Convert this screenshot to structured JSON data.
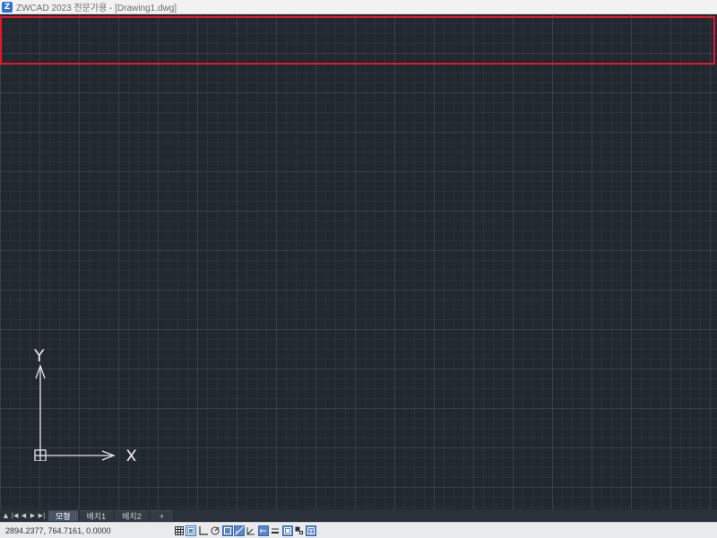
{
  "window": {
    "logo_glyph": "Z",
    "title": "ZWCAD 2023 전문가용 - [Drawing1.dwg]"
  },
  "canvas": {
    "background": "#212830",
    "highlight_color": "#e8162a",
    "axis_x_label": "X",
    "axis_y_label": "Y"
  },
  "layout_tabs": {
    "nav": [
      "▲",
      "|◀",
      "◀",
      "▶",
      "▶|"
    ],
    "tabs": [
      {
        "label": "모형",
        "active": true
      },
      {
        "label": "배치1",
        "active": false
      },
      {
        "label": "배치2",
        "active": false
      }
    ],
    "add_label": "+"
  },
  "status_bar": {
    "coordinates": "2894.2377, 764.7161, 0.0000",
    "toggles": [
      {
        "name": "grid-icon",
        "on": false
      },
      {
        "name": "snap-icon",
        "on": true
      },
      {
        "name": "ortho-icon",
        "on": false
      },
      {
        "name": "polar-icon",
        "on": false
      },
      {
        "name": "object-snap-icon",
        "on": true
      },
      {
        "name": "object-track-icon",
        "on": true
      },
      {
        "name": "dynamic-ucs-icon",
        "on": false
      },
      {
        "name": "dynamic-input-icon",
        "on": true
      },
      {
        "name": "lineweight-icon",
        "on": false
      },
      {
        "name": "model-space-icon",
        "on": true
      },
      {
        "name": "selection-cycling-icon",
        "on": false
      },
      {
        "name": "annotation-monitor-icon",
        "on": true
      }
    ]
  }
}
